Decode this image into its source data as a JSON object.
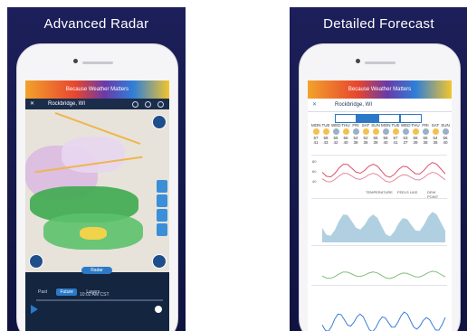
{
  "left_panel": {
    "title": "Advanced Radar",
    "banner_text": "Because Weather Matters",
    "location": "Rockbridge, WI",
    "bottom": {
      "pill_label": "Radar",
      "seg_label": "Future",
      "seg_options": [
        "Past",
        "Future",
        "Layers"
      ],
      "time_label": "10:02 AM CST"
    }
  },
  "right_panel": {
    "title": "Detailed Forecast",
    "banner_text": "Because Weather Matters",
    "location": "Rockbridge, WI",
    "days": [
      {
        "d": "MON",
        "hi": "57",
        "lo": "41",
        "c": "#f2c14e"
      },
      {
        "d": "TUE",
        "hi": "58",
        "lo": "43",
        "c": "#f2c14e"
      },
      {
        "d": "WED",
        "hi": "55",
        "lo": "42",
        "c": "#9ab0c8"
      },
      {
        "d": "THU",
        "hi": "56",
        "lo": "40",
        "c": "#f2c14e"
      },
      {
        "d": "FRI",
        "hi": "54",
        "lo": "38",
        "c": "#9ab0c8"
      },
      {
        "d": "SAT",
        "hi": "52",
        "lo": "36",
        "c": "#f2c14e"
      },
      {
        "d": "SUN",
        "hi": "55",
        "lo": "39",
        "c": "#f2c14e"
      },
      {
        "d": "MON",
        "hi": "58",
        "lo": "40",
        "c": "#9ab0c8"
      },
      {
        "d": "TUE",
        "hi": "57",
        "lo": "41",
        "c": "#f2c14e"
      },
      {
        "d": "WED",
        "hi": "53",
        "lo": "37",
        "c": "#9ab0c8"
      },
      {
        "d": "THU",
        "hi": "56",
        "lo": "39",
        "c": "#f2c14e"
      },
      {
        "d": "FRI",
        "hi": "55",
        "lo": "38",
        "c": "#9ab0c8"
      },
      {
        "d": "SAT",
        "hi": "54",
        "lo": "36",
        "c": "#f2c14e"
      },
      {
        "d": "SUN",
        "hi": "56",
        "lo": "40",
        "c": "#9ab0c8"
      }
    ],
    "chart_ticks": [
      "80",
      "60",
      "40"
    ],
    "legend": [
      "TEMPERATURE",
      "FEELS LIKE",
      "DEW POINT"
    ]
  },
  "colors": {
    "panel_bg": "#1d1f5a",
    "accent": "#2b79c7",
    "temp_line": "#d9516b",
    "precip": "#6fa8c9",
    "wind": "#3a7dd8"
  },
  "icons": {
    "close": "close-icon",
    "gear": "gear-icon",
    "share": "share-icon",
    "layers": "layers-icon",
    "play": "play-icon"
  }
}
